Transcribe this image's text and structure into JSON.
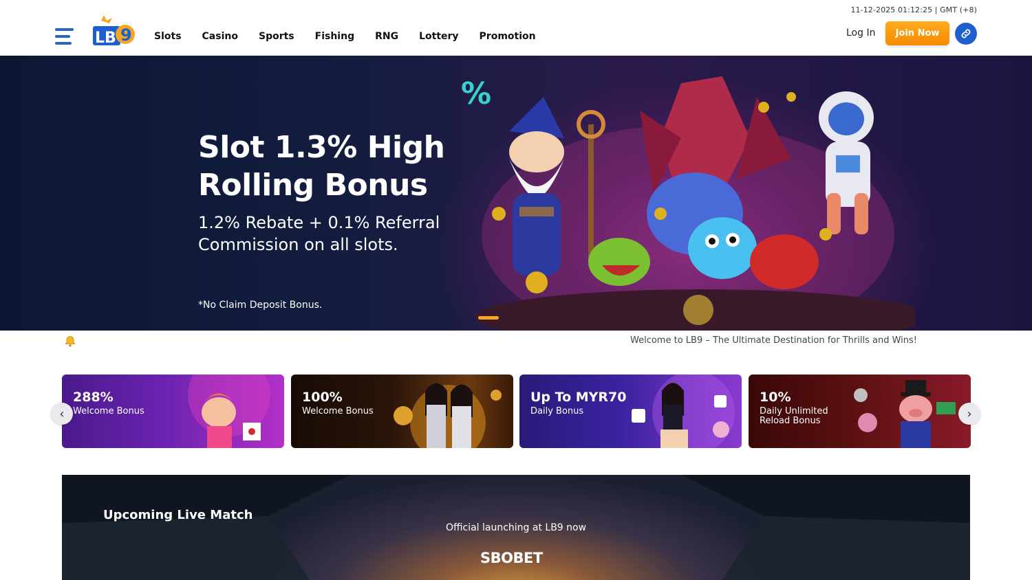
{
  "header": {
    "datetime": "11-12-2025 01:12:25 | GMT (+8)",
    "logo_text": "LB9",
    "nav": [
      "Slots",
      "Casino",
      "Sports",
      "Fishing",
      "RNG",
      "Lottery",
      "Promotion"
    ],
    "login_label": "Log In",
    "join_label": "Join Now",
    "menu_icon": "hamburger-icon",
    "link_icon": "link-icon"
  },
  "hero": {
    "title": "Slot 1.3% High Rolling Bonus",
    "subtitle": "1.2% Rebate + 0.1% Referral Commission on all slots.",
    "note": "*No Claim Deposit Bonus."
  },
  "marquee": {
    "icon": "bell-icon",
    "text": "Welcome to LB9 – The Ultimate Destination for Thrills and Wins!"
  },
  "promos": [
    {
      "title": "288%",
      "subtitle": "Welcome Bonus"
    },
    {
      "title": "100%",
      "subtitle": "Welcome Bonus"
    },
    {
      "title": "Up To MYR70",
      "subtitle": "Daily Bonus"
    },
    {
      "title": "10%",
      "subtitle": "Daily Unlimited Reload Bonus"
    }
  ],
  "carousel": {
    "prev_icon": "chevron-left-icon",
    "next_icon": "chevron-right-icon"
  },
  "live": {
    "title": "Upcoming Live Match",
    "subtitle": "Official launching at LB9 now",
    "brand": "SBOBET"
  },
  "colors": {
    "accent": "#f59a0c",
    "primary": "#1e5fd0"
  }
}
